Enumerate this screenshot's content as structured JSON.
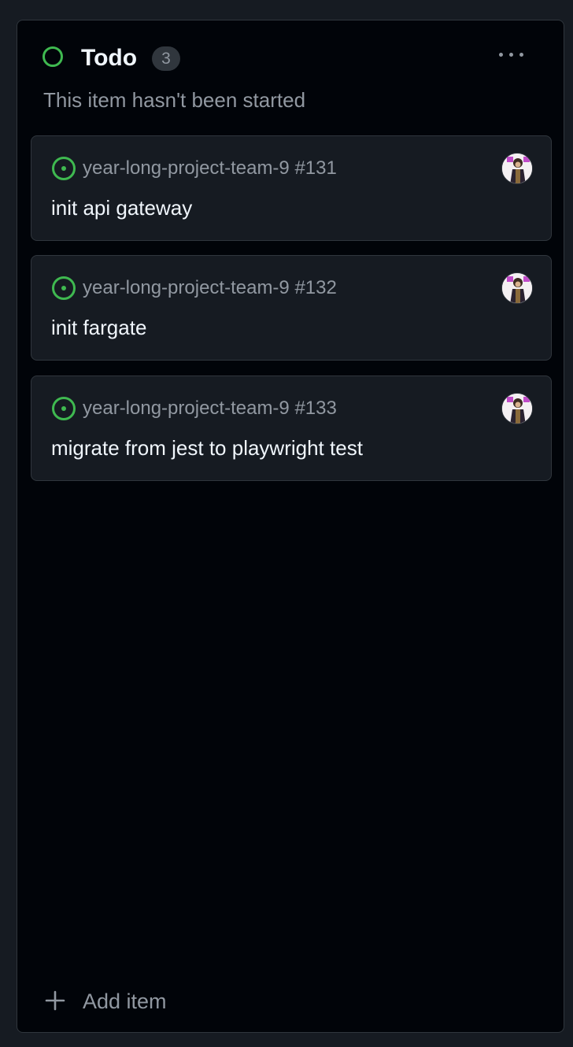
{
  "column": {
    "title": "Todo",
    "count": "3",
    "description": "This item hasn't been started",
    "status_color": "#3fb950"
  },
  "cards": [
    {
      "repo_ref": "year-long-project-team-9 #131",
      "title": "init api gateway",
      "status_icon": "issue-open-icon"
    },
    {
      "repo_ref": "year-long-project-team-9 #132",
      "title": "init fargate",
      "status_icon": "issue-open-icon"
    },
    {
      "repo_ref": "year-long-project-team-9 #133",
      "title": "migrate from jest to playwright test",
      "status_icon": "issue-open-icon"
    }
  ],
  "add_item": {
    "label": "Add item",
    "icon": "plus-icon"
  },
  "more_menu": {
    "icon": "kebab-horizontal-icon"
  },
  "theme": {
    "background": "#010409",
    "card": "#161b22",
    "border": "#30363d",
    "muted_text": "#9198a1",
    "open_green": "#3fb950"
  }
}
